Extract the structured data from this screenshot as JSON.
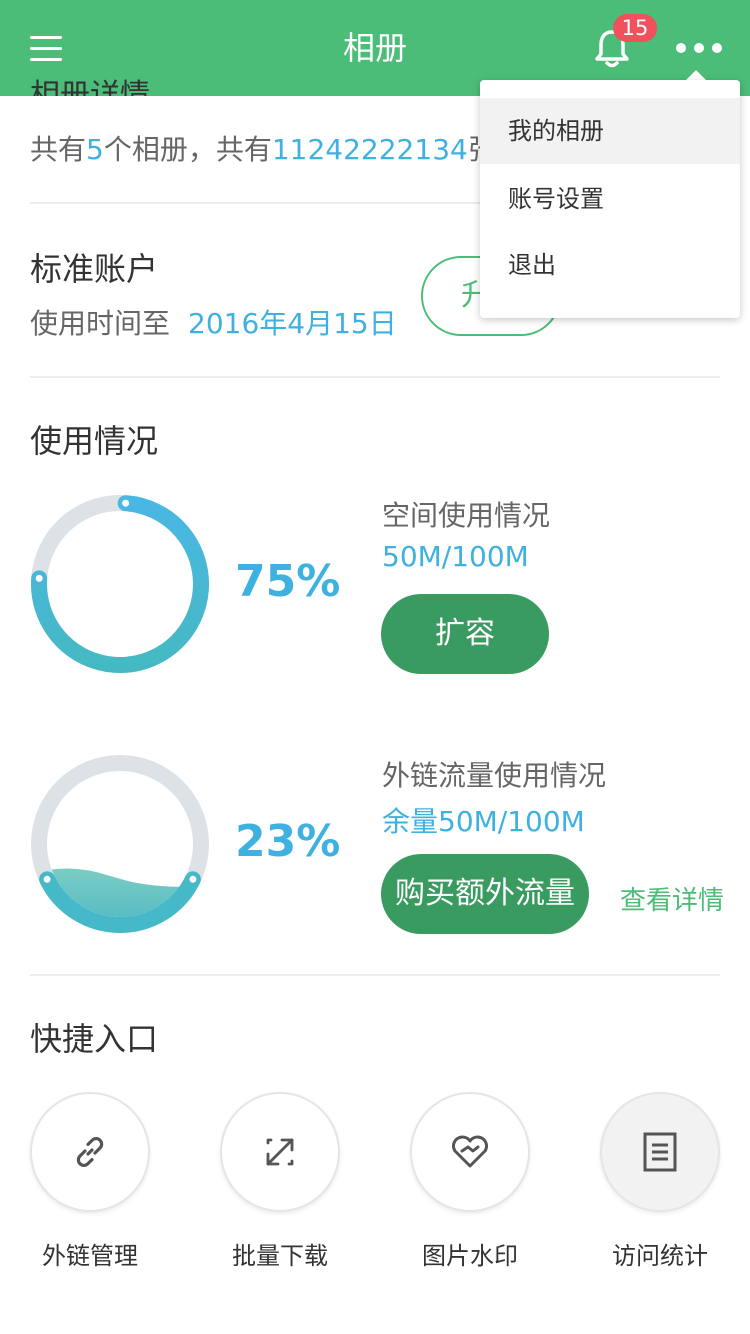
{
  "header": {
    "title": "相册",
    "notification_count": "15",
    "colors": {
      "bar": "#4bbd78",
      "badge": "#f0515c"
    }
  },
  "album_info": {
    "heading_partial": "相册详情",
    "prefix": "共有",
    "album_count": "5",
    "middle": "个相册，共有",
    "photo_count": "11242222134",
    "suffix": "张"
  },
  "account": {
    "title": "标准账户",
    "expire_label": "使用时间至",
    "expire_date": "2016年4月15日",
    "upgrade_label": "升"
  },
  "usage": {
    "title": "使用情况",
    "space": {
      "percent_text": "75%",
      "percent": 75,
      "label": "空间使用情况",
      "value": "50M/100M",
      "button": "扩容"
    },
    "traffic": {
      "percent_text": "23%",
      "percent": 23,
      "label": "外链流量使用情况",
      "value": "余量50M/100M",
      "button": "购买额外流量",
      "details_link": "查看详情"
    }
  },
  "quick": {
    "title": "快捷入口",
    "items": [
      {
        "label": "外链管理",
        "icon": "link-icon"
      },
      {
        "label": "批量下载",
        "icon": "expand-arrows-icon"
      },
      {
        "label": "图片水印",
        "icon": "heart-icon"
      },
      {
        "label": "访问统计",
        "icon": "document-icon"
      }
    ]
  },
  "menu": {
    "items": [
      "我的相册",
      "账号设置",
      "退出"
    ]
  }
}
